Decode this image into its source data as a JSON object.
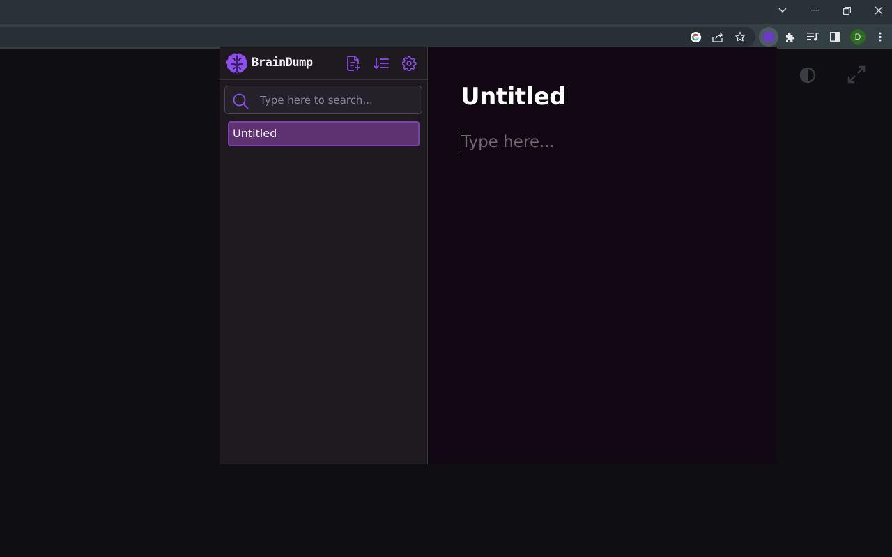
{
  "browser": {
    "profile_initial": "D",
    "window_controls": [
      "tab-search-icon",
      "minimize-icon",
      "restore-icon",
      "close-icon"
    ],
    "toolbar_icons": [
      "google-icon",
      "share-icon",
      "bookmark-star-icon",
      "braindump-extension-icon",
      "extensions-puzzle-icon",
      "media-queue-icon",
      "side-panel-icon",
      "menu-dots-icon"
    ]
  },
  "popup": {
    "brand": {
      "name": "BrainDump",
      "accent": "#8f4ef0"
    },
    "header_actions": [
      "new-note-icon",
      "sort-icon",
      "settings-icon"
    ],
    "search": {
      "placeholder": "Type here to search...",
      "value": ""
    },
    "notes": [
      {
        "title": "Untitled",
        "selected": true
      }
    ],
    "editor": {
      "title": "Untitled",
      "body_placeholder": "Type here..."
    }
  },
  "page_controls": [
    "contrast-icon",
    "expand-icon"
  ]
}
